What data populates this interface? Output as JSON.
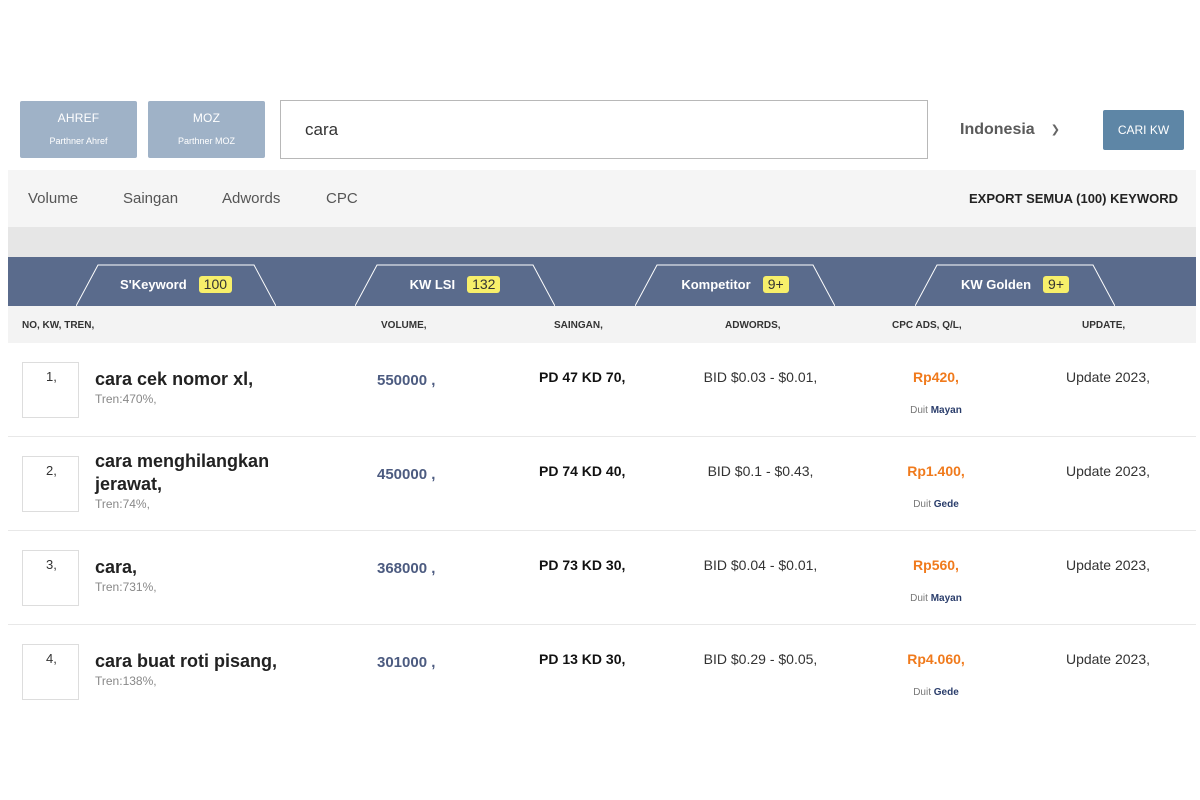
{
  "partners": [
    {
      "name": "AHREF",
      "sub": "Parthner Ahref"
    },
    {
      "name": "MOZ",
      "sub": "Parthner MOZ"
    }
  ],
  "search": {
    "value": "cara",
    "placeholder": ""
  },
  "country": {
    "selected": "Indonesia"
  },
  "search_button": "CARI KW",
  "filters": [
    "Volume",
    "Saingan",
    "Adwords",
    "CPC"
  ],
  "export_label": "EXPORT SEMUA (100) KEYWORD",
  "tabs": [
    {
      "label": "S'Keyword",
      "badge": "100"
    },
    {
      "label": "KW LSI",
      "badge": "132"
    },
    {
      "label": "Kompetitor",
      "badge": "9+"
    },
    {
      "label": "KW Golden",
      "badge": "9+"
    }
  ],
  "columns": [
    "NO, KW, TREN,",
    "VOLUME,",
    "SAINGAN,",
    "ADWORDS,",
    "CPC ADS, Q/L,",
    "UPDATE,"
  ],
  "rows": [
    {
      "no": "1,",
      "kw": "cara cek nomor xl,",
      "tren": "Tren:470%,",
      "volume": "550000 ,",
      "saingan": "PD 47 KD 70,",
      "adwords": "BID $0.03 - $0.01,",
      "cpc": "Rp420,",
      "duit_prefix": "Duit",
      "duit_value": "Mayan",
      "update": "Update 2023,"
    },
    {
      "no": "2,",
      "kw": "cara menghilangkan jerawat,",
      "tren": "Tren:74%,",
      "volume": "450000 ,",
      "saingan": "PD 74 KD 40,",
      "adwords": "BID $0.1 - $0.43,",
      "cpc": "Rp1.400,",
      "duit_prefix": "Duit",
      "duit_value": "Gede",
      "update": "Update 2023,"
    },
    {
      "no": "3,",
      "kw": "cara,",
      "tren": "Tren:731%,",
      "volume": "368000 ,",
      "saingan": "PD 73 KD 30,",
      "adwords": "BID $0.04 - $0.01,",
      "cpc": "Rp560,",
      "duit_prefix": "Duit",
      "duit_value": "Mayan",
      "update": "Update 2023,"
    },
    {
      "no": "4,",
      "kw": "cara buat roti pisang,",
      "tren": "Tren:138%,",
      "volume": "301000 ,",
      "saingan": "PD 13 KD 30,",
      "adwords": "BID $0.29 - $0.05,",
      "cpc": "Rp4.060,",
      "duit_prefix": "Duit",
      "duit_value": "Gede",
      "update": "Update 2023,"
    }
  ]
}
